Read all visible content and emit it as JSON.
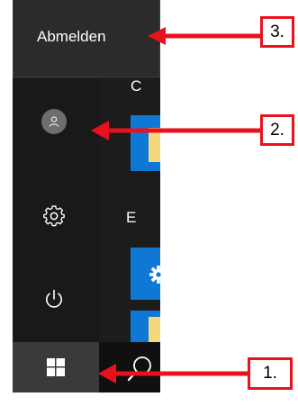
{
  "flyout": {
    "sign_out_label": "Abmelden"
  },
  "app_list": {
    "letters": [
      "C",
      "E"
    ]
  },
  "icons": {
    "user": "user-avatar-icon",
    "settings": "gear-icon",
    "power": "power-icon",
    "start": "windows-logo-icon",
    "search": "search-icon",
    "app_tile": "gear-icon"
  },
  "annotations": {
    "step1": "1.",
    "step2": "2.",
    "step3": "3."
  },
  "colors": {
    "annotation_red": "#e8121f",
    "tile_blue": "#0f78d4",
    "folder_yellow": "#f7d77c",
    "menu_dark": "#1f1f1f"
  }
}
